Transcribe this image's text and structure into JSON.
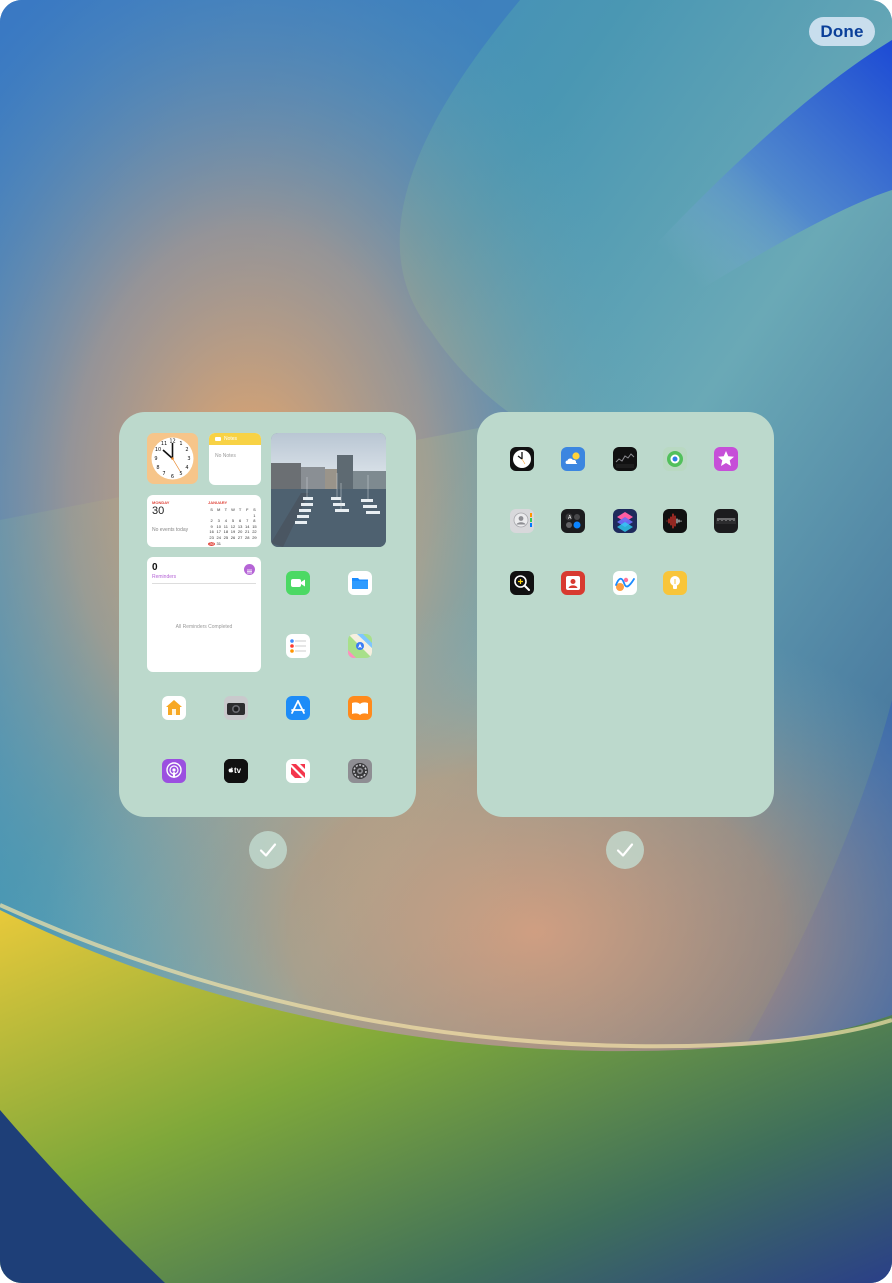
{
  "toolbar": {
    "done_label": "Done"
  },
  "page1": {
    "notes_widget": {
      "title": "Notes",
      "empty_text": "No Notes"
    },
    "calendar_widget": {
      "weekday": "MONDAY",
      "day": "30",
      "no_events": "No events today",
      "month": "JANUARY",
      "weekday_initials": [
        "S",
        "M",
        "T",
        "W",
        "T",
        "F",
        "S"
      ],
      "dates": [
        "",
        "",
        "",
        "",
        "",
        "",
        "1",
        "2",
        "3",
        "4",
        "5",
        "6",
        "7",
        "8",
        "9",
        "10",
        "11",
        "12",
        "13",
        "14",
        "15",
        "16",
        "17",
        "18",
        "19",
        "20",
        "21",
        "22",
        "23",
        "24",
        "25",
        "26",
        "27",
        "28",
        "29",
        "30",
        "31"
      ]
    },
    "reminders_widget": {
      "count": "0",
      "title": "Reminders",
      "status": "All Reminders Completed"
    },
    "apps": [
      "facetime-icon",
      "files-icon",
      "reminders-icon",
      "maps-icon",
      "home-icon",
      "camera-icon",
      "app-store-icon",
      "books-icon",
      "podcasts-icon",
      "apple-tv-icon",
      "news-icon",
      "settings-icon"
    ],
    "tv_label": "tv"
  },
  "page2": {
    "apps": [
      "clock-icon",
      "weather-icon",
      "stocks-icon",
      "find-my-icon",
      "itunes-store-icon",
      "contacts-icon",
      "utilities-folder-icon",
      "shortcuts-icon",
      "voice-memos-icon",
      "measure-icon",
      "magnifier-icon",
      "photo-booth-icon",
      "freeform-icon",
      "tips-icon"
    ]
  },
  "colors": {
    "card": "#bcd9cc",
    "done_text": "#0a3f99",
    "reminders_accent": "#b564d6",
    "calendar_red": "#e0463c"
  }
}
